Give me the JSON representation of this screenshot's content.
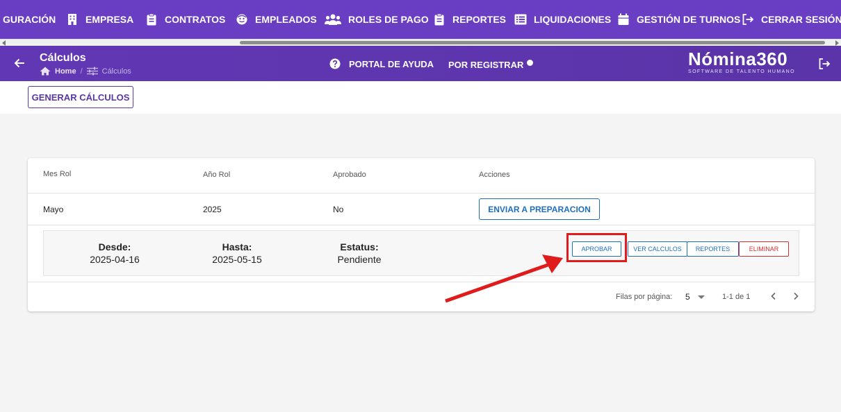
{
  "topnav": {
    "items": [
      {
        "label": "GURACIÓN",
        "icon": "settings-icon"
      },
      {
        "label": "EMPRESA",
        "icon": "building-icon"
      },
      {
        "label": "CONTRATOS",
        "icon": "clipboard-icon"
      },
      {
        "label": "EMPLEADOS",
        "icon": "face-icon"
      },
      {
        "label": "ROLES DE PAGO",
        "icon": "people-icon"
      },
      {
        "label": "REPORTES",
        "icon": "clipboard-icon"
      },
      {
        "label": "LIQUIDACIONES",
        "icon": "list-icon"
      },
      {
        "label": "GESTIÓN DE TURNOS",
        "icon": "calendar-icon"
      },
      {
        "label": "CERRAR SESIÓN",
        "icon": "logout-icon"
      }
    ]
  },
  "header": {
    "title": "Cálculos",
    "breadcrumb_home": "Home",
    "breadcrumb_separator": "/",
    "breadcrumb_current": "Cálculos",
    "help_label": "PORTAL DE AYUDA",
    "register_label": "POR REGISTRAR",
    "logo_main": "Nómina360",
    "logo_sub": "SOFTWARE DE TALENTO HUMANO"
  },
  "actions": {
    "generate_label": "GENERAR CÁLCULOS"
  },
  "table": {
    "columns": [
      "Mes Rol",
      "Año Rol",
      "Aprobado",
      "Acciones"
    ],
    "rows": [
      {
        "mes": "Mayo",
        "anio": "2025",
        "aprobado": "No",
        "action_label": "ENVIAR A PREPARACION"
      }
    ],
    "detail": {
      "desde_label": "Desde:",
      "desde_value": "2025-04-16",
      "hasta_label": "Hasta:",
      "hasta_value": "2025-05-15",
      "estatus_label": "Estatus:",
      "estatus_value": "Pendiente",
      "buttons": {
        "aprobar": "APROBAR",
        "ver_calculos": "VER CALCULOS",
        "reportes": "REPORTES",
        "eliminar": "ELIMINAR"
      }
    },
    "footer": {
      "rows_per_page_label": "Filas por página:",
      "rows_per_page_value": "5",
      "range": "1-1 de 1"
    }
  },
  "colors": {
    "nav_purple": "#6a3ec2",
    "header_purple": "#5a34a8",
    "button_blue": "#1f6fbf",
    "delete_red": "#d32f2f",
    "annotation_red": "#e01b1b"
  }
}
